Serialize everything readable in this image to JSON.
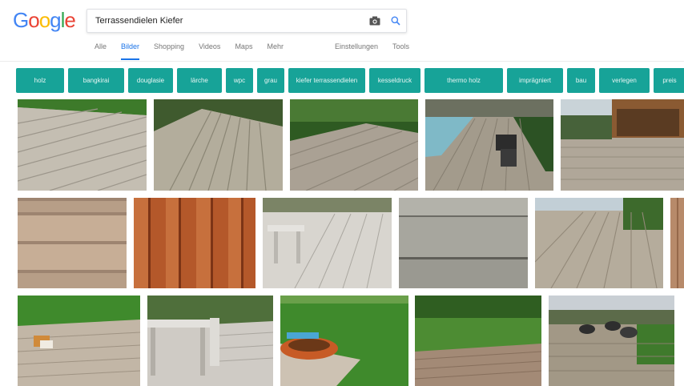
{
  "logo": {
    "letters": [
      "G",
      "o",
      "o",
      "g",
      "l",
      "e"
    ]
  },
  "search": {
    "query": "Terrassendielen Kiefer"
  },
  "tabs": [
    {
      "label": "Alle",
      "active": false
    },
    {
      "label": "Bilder",
      "active": true
    },
    {
      "label": "Shopping",
      "active": false
    },
    {
      "label": "Videos",
      "active": false
    },
    {
      "label": "Maps",
      "active": false
    },
    {
      "label": "Mehr",
      "active": false
    },
    {
      "label": "Einstellungen",
      "active": false
    },
    {
      "label": "Tools",
      "active": false
    }
  ],
  "chips": [
    {
      "label": "holz"
    },
    {
      "label": "bangkirai"
    },
    {
      "label": "douglasie"
    },
    {
      "label": "lärche"
    },
    {
      "label": "wpc"
    },
    {
      "label": "grau"
    },
    {
      "label": "kiefer terrassendielen"
    },
    {
      "label": "kesseldruck"
    },
    {
      "label": "thermo holz"
    },
    {
      "label": "imprägniert"
    },
    {
      "label": "bau"
    },
    {
      "label": "verlegen"
    },
    {
      "label": "preis"
    }
  ],
  "colors": {
    "chip_bg": "#17a398",
    "active_tab": "#1a73e8",
    "deck_grey": "#b9b2a8",
    "deck_brown": "#b4582a",
    "grass": "#3f8a2c"
  },
  "icons": [
    "camera-icon",
    "search-icon"
  ]
}
